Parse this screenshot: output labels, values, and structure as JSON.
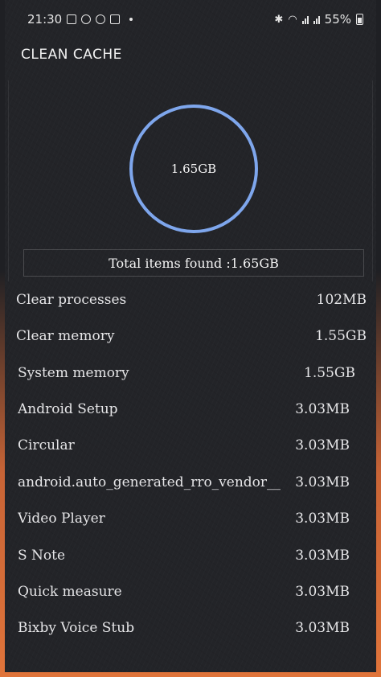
{
  "status_bar": {
    "time": "21:30",
    "battery": "55%"
  },
  "header": {
    "title": "CLEAN CACHE"
  },
  "summary": {
    "ring_value": "1.65GB",
    "total_label": "Total items found :1.65GB"
  },
  "items": [
    {
      "name": "Clear processes",
      "size": "102MB"
    },
    {
      "name": "Clear memory",
      "size": "1.55GB"
    },
    {
      "name": "System memory",
      "size": "1.55GB"
    },
    {
      "name": "Android Setup",
      "size": "3.03MB"
    },
    {
      "name": "Circular",
      "size": "3.03MB"
    },
    {
      "name": "android.auto_generated_rro_vendor__",
      "size": "3.03MB"
    },
    {
      "name": "Video Player",
      "size": "3.03MB"
    },
    {
      "name": "S Note",
      "size": "3.03MB"
    },
    {
      "name": "Quick measure",
      "size": "3.03MB"
    },
    {
      "name": "Bixby Voice Stub",
      "size": "3.03MB"
    }
  ],
  "colors": {
    "ring": "#7ea6ec",
    "background": "#232428",
    "frame_accent": "#e0743a"
  }
}
